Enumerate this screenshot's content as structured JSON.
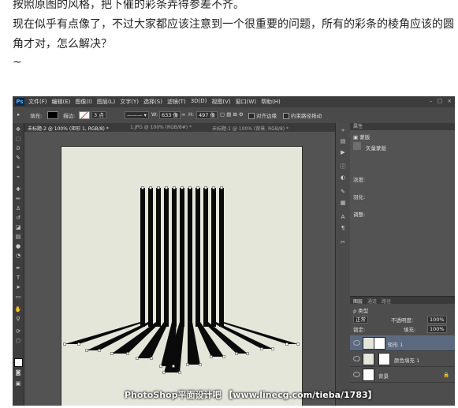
{
  "post": {
    "line1": "按照原图的风格，把下催的彩条弄得参差不齐。",
    "line2": "现在似乎有点像了，不过大家都应该注意到一个很重要的问题，所有的彩条的棱角应该的圆",
    "line3": "角才对，怎么解决？",
    "line4": "~"
  },
  "app": {
    "logo": "Ps",
    "menus": [
      "文件(F)",
      "编辑(E)",
      "图像(I)",
      "图层(L)",
      "文字(Y)",
      "选择(S)",
      "滤镜(T)",
      "3D(D)",
      "视图(V)",
      "窗口(W)",
      "帮助(H)"
    ],
    "window_controls": [
      "–",
      "□",
      "×"
    ]
  },
  "options": {
    "fill_label": "填充:",
    "stroke_label": "描边:",
    "stroke_width": "3 点",
    "w_label": "W:",
    "w_value": "633 像",
    "h_label": "H:",
    "h_value": "497 像",
    "align_edges": "对齐边缘",
    "constrain_path": "约束路径拖动"
  },
  "tabs": [
    {
      "label": "未标题-2 @ 100% (矩形 1, RGB/8) *",
      "active": true
    },
    {
      "label": "1.JPG @ 100% (RGB/8#) *",
      "active": false
    },
    {
      "label": "未标题-1 @ 100% (背景, RGB/8) *",
      "active": false
    }
  ],
  "panel": {
    "title": "属性",
    "mask_label": "蒙版",
    "vector_mask_label": "矢量蒙版",
    "density_label": "浓度:",
    "feather_label": "羽化:",
    "refine_label": "调整:"
  },
  "layers": {
    "tabs": [
      "图层",
      "通道",
      "路径"
    ],
    "kind_label": "ρ 类型",
    "blend_mode": "正常",
    "opacity_label": "不透明度:",
    "opacity_value": "100%",
    "lock_label": "锁定:",
    "fill_label": "填充:",
    "fill_value": "100%",
    "rows": [
      {
        "name": "矩形 1",
        "selected": true
      },
      {
        "name": "颜色填充 1",
        "selected": false
      },
      {
        "name": "背景",
        "selected": false
      }
    ]
  },
  "watermark": "PhotoShop平面设计吧 【www.linecg.com/tieba/1783】",
  "colors": {
    "canvas_bg": "#e4e6da",
    "stripe": "#0a0a0a",
    "ui_dark": "#3c3c3c",
    "selection": "#5c6a80"
  },
  "icons": [
    "move-icon",
    "marquee-icon",
    "lasso-icon",
    "quick-select-icon",
    "crop-icon",
    "eyedropper-icon",
    "healing-icon",
    "brush-icon",
    "stamp-icon",
    "history-brush-icon",
    "eraser-icon",
    "gradient-icon",
    "blur-icon",
    "dodge-icon",
    "pen-icon",
    "type-icon",
    "path-select-icon",
    "shape-icon",
    "hand-icon",
    "zoom-icon",
    "eye-icon"
  ]
}
